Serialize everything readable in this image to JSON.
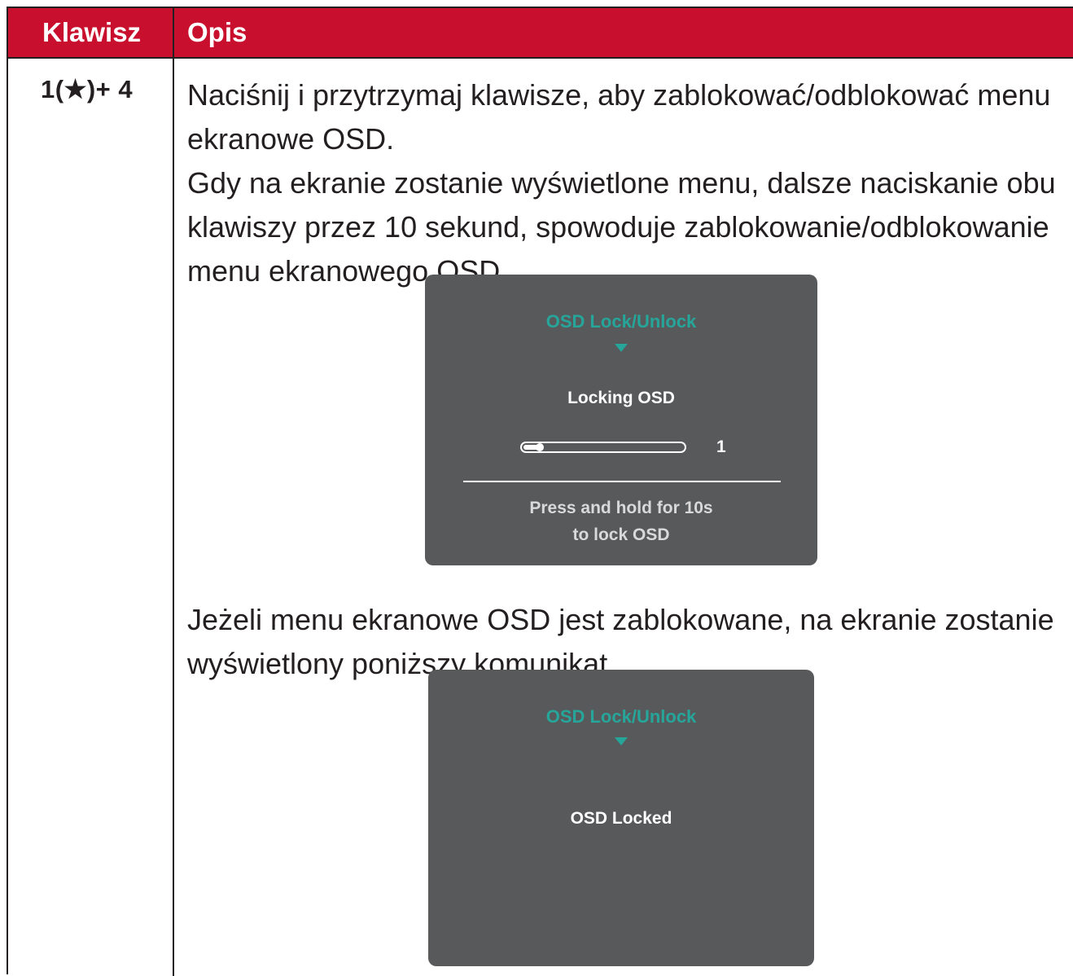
{
  "table": {
    "headers": {
      "key": "Klawisz",
      "description": "Opis"
    },
    "row": {
      "key": "1(★)+ 4",
      "paragraphs": [
        "Naciśnij i przytrzymaj klawisze, aby zablokować/odblokować menu ekranowe OSD.",
        "Gdy na ekranie zostanie wyświetlone menu, dalsze naciskanie obu klawiszy przez 10 sekund, spowoduje zablokowanie/odblokowanie menu ekranowego OSD.",
        "Jeżeli menu ekranowe OSD jest zablokowane, na ekranie zostanie wyświetlony poniższy komunikat."
      ]
    }
  },
  "osd_locking": {
    "title": "OSD Lock/Unlock",
    "status": "Locking OSD",
    "progress_value": "1",
    "progress_fraction": 0.1,
    "hint_line1": "Press and hold for 10s",
    "hint_line2": "to lock OSD"
  },
  "osd_locked": {
    "title": "OSD Lock/Unlock",
    "status": "OSD Locked"
  },
  "colors": {
    "header_bg": "#c8102e",
    "osd_bg": "#58595b",
    "osd_accent": "#26a69a"
  }
}
